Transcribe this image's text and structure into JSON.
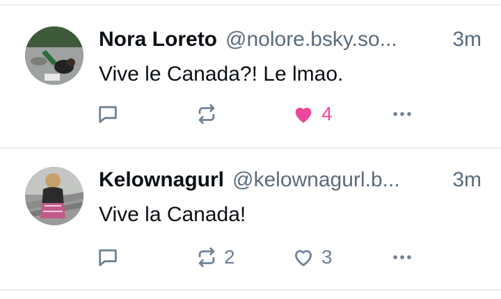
{
  "posts": [
    {
      "author_name": "Nora Loreto",
      "handle": "@nolore.bsky.so...",
      "time": "3m",
      "text": "Vive le Canada?! Le lmao.",
      "reply_count": "",
      "repost_count": "",
      "like_count": "4",
      "liked": true
    },
    {
      "author_name": "Kelownagurl",
      "handle": "@kelownagurl.b...",
      "time": "3m",
      "text": "Vive la Canada!",
      "reply_count": "",
      "repost_count": "2",
      "like_count": "3",
      "liked": false
    }
  ],
  "colors": {
    "like_active": "#ec4899",
    "icon_muted": "#6f8195",
    "handle_gray": "#5a6b7d",
    "divider": "#e8ecf0"
  },
  "icons": [
    "reply-icon",
    "repost-icon",
    "heart-icon",
    "more-icon"
  ]
}
